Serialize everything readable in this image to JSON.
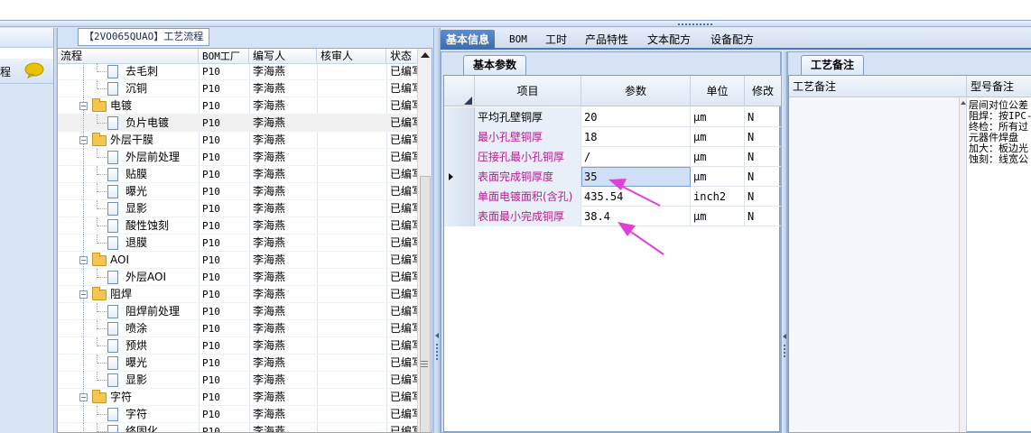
{
  "left_panel": {
    "row_text": "程",
    "chat_icon": "speech-bubble-icon"
  },
  "tree": {
    "title": "【2VO065QUAO】工艺流程",
    "columns": [
      "流程",
      "BOM工厂",
      "编写人",
      "核审人",
      "状态"
    ],
    "rows": [
      {
        "kind": "leaf",
        "name": "去毛刺",
        "factory": "P10",
        "writer": "李海燕",
        "reviewer": "",
        "status": "已编写"
      },
      {
        "kind": "leaf",
        "name": "沉铜",
        "factory": "P10",
        "writer": "李海燕",
        "reviewer": "",
        "status": "已编写"
      },
      {
        "kind": "folder",
        "name": "电镀",
        "factory": "P10",
        "writer": "李海燕",
        "reviewer": "",
        "status": "已编写"
      },
      {
        "kind": "leaf",
        "name": "负片电镀",
        "factory": "P10",
        "writer": "李海燕",
        "reviewer": "",
        "status": "已编写",
        "selected": true
      },
      {
        "kind": "folder",
        "name": "外层干膜",
        "factory": "P10",
        "writer": "李海燕",
        "reviewer": "",
        "status": "已编写"
      },
      {
        "kind": "leaf",
        "name": "外层前处理",
        "factory": "P10",
        "writer": "李海燕",
        "reviewer": "",
        "status": "已编写"
      },
      {
        "kind": "leaf",
        "name": "贴膜",
        "factory": "P10",
        "writer": "李海燕",
        "reviewer": "",
        "status": "已编写"
      },
      {
        "kind": "leaf",
        "name": "曝光",
        "factory": "P10",
        "writer": "李海燕",
        "reviewer": "",
        "status": "已编写"
      },
      {
        "kind": "leaf",
        "name": "显影",
        "factory": "P10",
        "writer": "李海燕",
        "reviewer": "",
        "status": "已编写"
      },
      {
        "kind": "leaf",
        "name": "酸性蚀刻",
        "factory": "P10",
        "writer": "李海燕",
        "reviewer": "",
        "status": "已编写"
      },
      {
        "kind": "leaf",
        "name": "退膜",
        "factory": "P10",
        "writer": "李海燕",
        "reviewer": "",
        "status": "已编写"
      },
      {
        "kind": "folder",
        "name": "AOI",
        "factory": "P10",
        "writer": "李海燕",
        "reviewer": "",
        "status": "已编写"
      },
      {
        "kind": "leaf",
        "name": "外层AOI",
        "factory": "P10",
        "writer": "李海燕",
        "reviewer": "",
        "status": "已编写"
      },
      {
        "kind": "folder",
        "name": "阻焊",
        "factory": "P10",
        "writer": "李海燕",
        "reviewer": "",
        "status": "已编写"
      },
      {
        "kind": "leaf",
        "name": "阻焊前处理",
        "factory": "P10",
        "writer": "李海燕",
        "reviewer": "",
        "status": "已编写"
      },
      {
        "kind": "leaf",
        "name": "喷涂",
        "factory": "P10",
        "writer": "李海燕",
        "reviewer": "",
        "status": "已编写"
      },
      {
        "kind": "leaf",
        "name": "预烘",
        "factory": "P10",
        "writer": "李海燕",
        "reviewer": "",
        "status": "已编写"
      },
      {
        "kind": "leaf",
        "name": "曝光",
        "factory": "P10",
        "writer": "李海燕",
        "reviewer": "",
        "status": "已编写"
      },
      {
        "kind": "leaf",
        "name": "显影",
        "factory": "P10",
        "writer": "李海燕",
        "reviewer": "",
        "status": "已编写"
      },
      {
        "kind": "folder",
        "name": "字符",
        "factory": "P10",
        "writer": "李海燕",
        "reviewer": "",
        "status": "已编写"
      },
      {
        "kind": "leaf",
        "name": "字符",
        "factory": "P10",
        "writer": "李海燕",
        "reviewer": "",
        "status": "已编写"
      },
      {
        "kind": "leaf",
        "name": "终固化",
        "factory": "P10",
        "writer": "李海燕",
        "reviewer": "",
        "status": "已编写"
      }
    ]
  },
  "tabs": [
    {
      "label": "基本信息",
      "active": true
    },
    {
      "label": "BOM",
      "active": false
    },
    {
      "label": "工时",
      "active": false
    },
    {
      "label": "产品特性",
      "active": false
    },
    {
      "label": "文本配方",
      "active": false
    },
    {
      "label": "设备配方",
      "active": false
    }
  ],
  "params": {
    "tab_label": "基本参数",
    "columns": [
      "项目",
      "参数",
      "单位",
      "修改"
    ],
    "label_color": "#b0208c",
    "rows": [
      {
        "item": "平均孔壁铜厚",
        "value": "20",
        "unit": "μm",
        "flag": "N",
        "highlight": false
      },
      {
        "item": "最小孔壁铜厚",
        "value": "18",
        "unit": "μm",
        "flag": "N",
        "highlight": true
      },
      {
        "item": "压接孔最小孔铜厚",
        "value": "/",
        "unit": "μm",
        "flag": "N",
        "highlight": true
      },
      {
        "item": "表面完成铜厚度",
        "value": "35",
        "unit": "μm",
        "flag": "N",
        "highlight": true,
        "current": true
      },
      {
        "item": "单面电镀面积(含孔)",
        "value": "435.54",
        "unit": "inch2",
        "flag": "N",
        "highlight": true
      },
      {
        "item": "表面最小完成铜厚",
        "value": "38.4",
        "unit": "μm",
        "flag": "N",
        "highlight": true
      }
    ]
  },
  "notes": {
    "tab_label": "工艺备注",
    "columns": [
      "工艺备注",
      "型号备注"
    ],
    "model_note_lines": [
      "层间对位公差",
      "阻焊：按IPC-",
      "终检：所有过",
      "元器件焊盘",
      "加大：板边光",
      "蚀刻：线宽公"
    ]
  },
  "annotation_color": "#e23fd6"
}
